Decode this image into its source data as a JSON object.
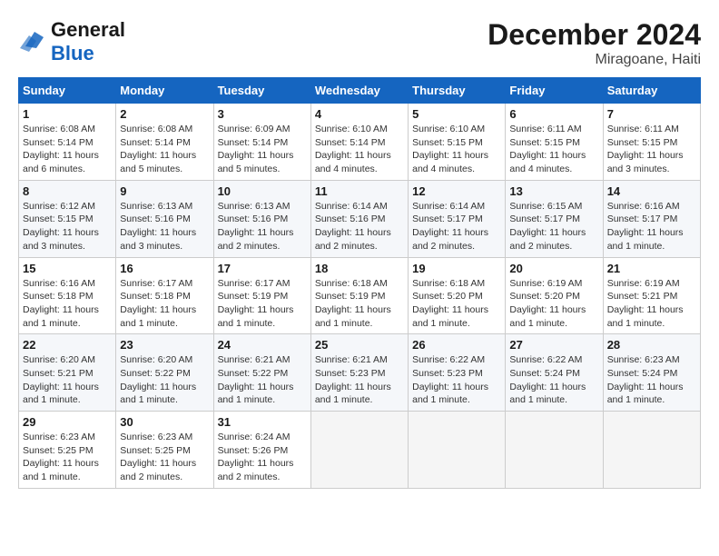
{
  "header": {
    "logo_general": "General",
    "logo_blue": "Blue",
    "month": "December 2024",
    "location": "Miragoane, Haiti"
  },
  "days_of_week": [
    "Sunday",
    "Monday",
    "Tuesday",
    "Wednesday",
    "Thursday",
    "Friday",
    "Saturday"
  ],
  "weeks": [
    [
      {
        "day": "1",
        "info": "Sunrise: 6:08 AM\nSunset: 5:14 PM\nDaylight: 11 hours and 6 minutes."
      },
      {
        "day": "2",
        "info": "Sunrise: 6:08 AM\nSunset: 5:14 PM\nDaylight: 11 hours and 5 minutes."
      },
      {
        "day": "3",
        "info": "Sunrise: 6:09 AM\nSunset: 5:14 PM\nDaylight: 11 hours and 5 minutes."
      },
      {
        "day": "4",
        "info": "Sunrise: 6:10 AM\nSunset: 5:14 PM\nDaylight: 11 hours and 4 minutes."
      },
      {
        "day": "5",
        "info": "Sunrise: 6:10 AM\nSunset: 5:15 PM\nDaylight: 11 hours and 4 minutes."
      },
      {
        "day": "6",
        "info": "Sunrise: 6:11 AM\nSunset: 5:15 PM\nDaylight: 11 hours and 4 minutes."
      },
      {
        "day": "7",
        "info": "Sunrise: 6:11 AM\nSunset: 5:15 PM\nDaylight: 11 hours and 3 minutes."
      }
    ],
    [
      {
        "day": "8",
        "info": "Sunrise: 6:12 AM\nSunset: 5:15 PM\nDaylight: 11 hours and 3 minutes."
      },
      {
        "day": "9",
        "info": "Sunrise: 6:13 AM\nSunset: 5:16 PM\nDaylight: 11 hours and 3 minutes."
      },
      {
        "day": "10",
        "info": "Sunrise: 6:13 AM\nSunset: 5:16 PM\nDaylight: 11 hours and 2 minutes."
      },
      {
        "day": "11",
        "info": "Sunrise: 6:14 AM\nSunset: 5:16 PM\nDaylight: 11 hours and 2 minutes."
      },
      {
        "day": "12",
        "info": "Sunrise: 6:14 AM\nSunset: 5:17 PM\nDaylight: 11 hours and 2 minutes."
      },
      {
        "day": "13",
        "info": "Sunrise: 6:15 AM\nSunset: 5:17 PM\nDaylight: 11 hours and 2 minutes."
      },
      {
        "day": "14",
        "info": "Sunrise: 6:16 AM\nSunset: 5:17 PM\nDaylight: 11 hours and 1 minute."
      }
    ],
    [
      {
        "day": "15",
        "info": "Sunrise: 6:16 AM\nSunset: 5:18 PM\nDaylight: 11 hours and 1 minute."
      },
      {
        "day": "16",
        "info": "Sunrise: 6:17 AM\nSunset: 5:18 PM\nDaylight: 11 hours and 1 minute."
      },
      {
        "day": "17",
        "info": "Sunrise: 6:17 AM\nSunset: 5:19 PM\nDaylight: 11 hours and 1 minute."
      },
      {
        "day": "18",
        "info": "Sunrise: 6:18 AM\nSunset: 5:19 PM\nDaylight: 11 hours and 1 minute."
      },
      {
        "day": "19",
        "info": "Sunrise: 6:18 AM\nSunset: 5:20 PM\nDaylight: 11 hours and 1 minute."
      },
      {
        "day": "20",
        "info": "Sunrise: 6:19 AM\nSunset: 5:20 PM\nDaylight: 11 hours and 1 minute."
      },
      {
        "day": "21",
        "info": "Sunrise: 6:19 AM\nSunset: 5:21 PM\nDaylight: 11 hours and 1 minute."
      }
    ],
    [
      {
        "day": "22",
        "info": "Sunrise: 6:20 AM\nSunset: 5:21 PM\nDaylight: 11 hours and 1 minute."
      },
      {
        "day": "23",
        "info": "Sunrise: 6:20 AM\nSunset: 5:22 PM\nDaylight: 11 hours and 1 minute."
      },
      {
        "day": "24",
        "info": "Sunrise: 6:21 AM\nSunset: 5:22 PM\nDaylight: 11 hours and 1 minute."
      },
      {
        "day": "25",
        "info": "Sunrise: 6:21 AM\nSunset: 5:23 PM\nDaylight: 11 hours and 1 minute."
      },
      {
        "day": "26",
        "info": "Sunrise: 6:22 AM\nSunset: 5:23 PM\nDaylight: 11 hours and 1 minute."
      },
      {
        "day": "27",
        "info": "Sunrise: 6:22 AM\nSunset: 5:24 PM\nDaylight: 11 hours and 1 minute."
      },
      {
        "day": "28",
        "info": "Sunrise: 6:23 AM\nSunset: 5:24 PM\nDaylight: 11 hours and 1 minute."
      }
    ],
    [
      {
        "day": "29",
        "info": "Sunrise: 6:23 AM\nSunset: 5:25 PM\nDaylight: 11 hours and 1 minute."
      },
      {
        "day": "30",
        "info": "Sunrise: 6:23 AM\nSunset: 5:25 PM\nDaylight: 11 hours and 2 minutes."
      },
      {
        "day": "31",
        "info": "Sunrise: 6:24 AM\nSunset: 5:26 PM\nDaylight: 11 hours and 2 minutes."
      },
      null,
      null,
      null,
      null
    ]
  ]
}
